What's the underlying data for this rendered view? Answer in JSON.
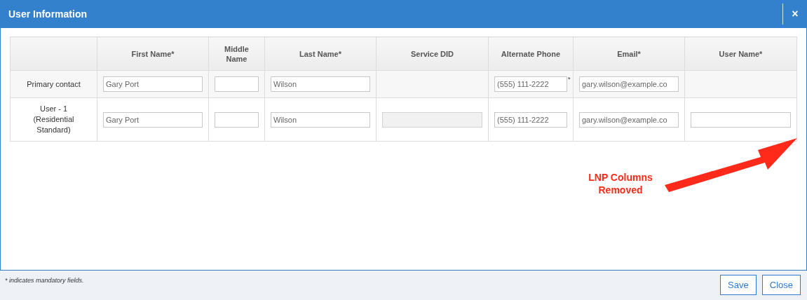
{
  "window": {
    "title": "User Information",
    "close": "×"
  },
  "table": {
    "columns": [
      "",
      "First Name*",
      "Middle Name",
      "Last Name*",
      "Service DID",
      "Alternate Phone",
      "Email*",
      "User Name*"
    ],
    "rows": [
      {
        "cells": [
          {
            "kind": "label",
            "text": "Primary contact"
          },
          {
            "kind": "input",
            "value": "Gary Port"
          },
          {
            "kind": "input"
          },
          {
            "kind": "input",
            "value": "Wilson"
          },
          {
            "kind": "empty"
          },
          {
            "kind": "input",
            "value": "(555) 111-2222",
            "mark": "*"
          },
          {
            "kind": "input",
            "value": "gary.wilson@example.co"
          },
          {
            "kind": "empty"
          }
        ]
      },
      {
        "cells": [
          {
            "kind": "label",
            "text": "User - 1 (Residential Standard)"
          },
          {
            "kind": "input",
            "value": "Gary Port"
          },
          {
            "kind": "input"
          },
          {
            "kind": "input",
            "value": "Wilson"
          },
          {
            "kind": "disabled"
          },
          {
            "kind": "input",
            "value": "(555) 111-2222"
          },
          {
            "kind": "input",
            "value": "gary.wilson@example.co"
          },
          {
            "kind": "input"
          }
        ]
      }
    ]
  },
  "annotation": {
    "text": "LNP Columns Removed"
  },
  "footer": {
    "note": "* indicates mandatory fields.",
    "buttons": [
      "Save",
      "Close"
    ]
  }
}
